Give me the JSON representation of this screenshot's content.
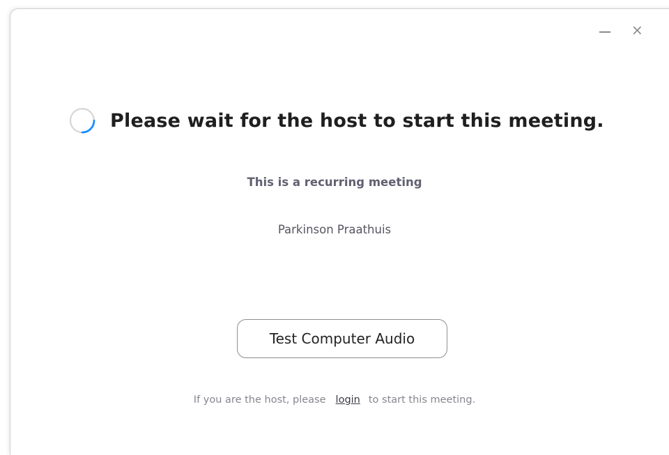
{
  "window": {
    "minimize_icon": "minimize-icon",
    "close_icon": "close-icon",
    "close_glyph": "×"
  },
  "status": {
    "spinner_icon": "loading-spinner-icon",
    "title": "Please wait for the host to start this meeting.",
    "subtitle": "This is a recurring meeting",
    "meeting_name": "Parkinson Praathuis"
  },
  "actions": {
    "test_audio_label": "Test Computer Audio"
  },
  "footer": {
    "prefix": "If you are the host, please",
    "login_link": "login",
    "suffix": "to start this meeting."
  },
  "colors": {
    "spinner_accent": "#1a8cff",
    "spinner_track": "#d6d6d6",
    "title_text": "#1f1f1f",
    "muted_text": "#85858f"
  }
}
